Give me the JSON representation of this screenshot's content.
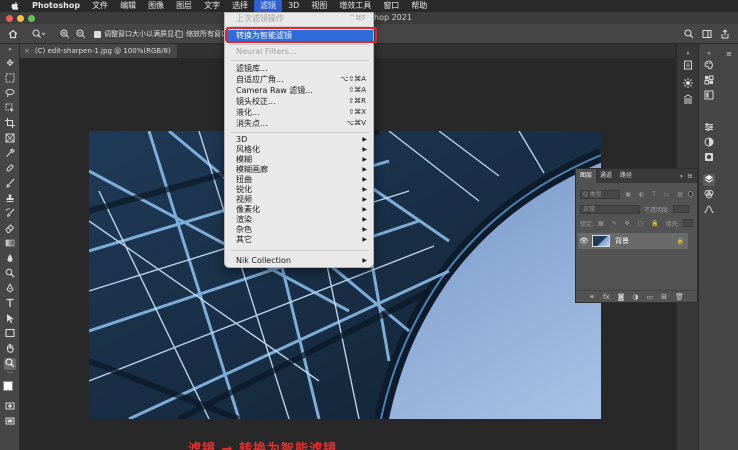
{
  "menubar": {
    "app_name": "Photoshop",
    "items": [
      "文件",
      "编辑",
      "图像",
      "图层",
      "文字",
      "选择",
      "滤镜",
      "3D",
      "视图",
      "增效工具",
      "窗口",
      "帮助"
    ],
    "active_item": "滤镜"
  },
  "window": {
    "title_fragment": "hop 2021"
  },
  "options_bar": {
    "fit_window_label": "调整窗口大小以满屏显示",
    "zoom_all_label": "缩放所有窗口"
  },
  "document_tab": {
    "label": "(C) edit-sharpen-1.jpg @ 100%(RGB/8)",
    "close_glyph": "×"
  },
  "filter_menu": {
    "items": [
      {
        "label": "上次滤镜操作",
        "shortcut": "^⌘F",
        "disabled": true
      },
      {
        "label": "转换为智能滤镜",
        "highlighted": true
      },
      {
        "label": "Neural Filters...",
        "disabled": true
      },
      {
        "label": "滤镜库..."
      },
      {
        "label": "自适应广角...",
        "shortcut": "⌥⇧⌘A"
      },
      {
        "label": "Camera Raw 滤镜...",
        "shortcut": "⇧⌘A"
      },
      {
        "label": "镜头校正...",
        "shortcut": "⇧⌘R"
      },
      {
        "label": "液化...",
        "shortcut": "⇧⌘X"
      },
      {
        "label": "消失点...",
        "shortcut": "⌥⌘V"
      },
      {
        "label": "3D",
        "submenu": true
      },
      {
        "label": "风格化",
        "submenu": true
      },
      {
        "label": "模糊",
        "submenu": true
      },
      {
        "label": "模糊画廊",
        "submenu": true
      },
      {
        "label": "扭曲",
        "submenu": true
      },
      {
        "label": "锐化",
        "submenu": true
      },
      {
        "label": "视频",
        "submenu": true
      },
      {
        "label": "像素化",
        "submenu": true
      },
      {
        "label": "渲染",
        "submenu": true
      },
      {
        "label": "杂色",
        "submenu": true
      },
      {
        "label": "其它",
        "submenu": true
      },
      {
        "label": "Nik Collection",
        "submenu": true
      }
    ]
  },
  "layers_panel": {
    "tabs": [
      "图层",
      "通道",
      "路径"
    ],
    "active_tab": "图层",
    "kind_filter": "Q 类型",
    "blend_mode": "正常",
    "opacity_label": "不透明度:",
    "lock_label": "锁定:",
    "fill_label": "填充:",
    "layer_name": "背景"
  },
  "caption": "滤镜 → 转换为智能滤镜"
}
